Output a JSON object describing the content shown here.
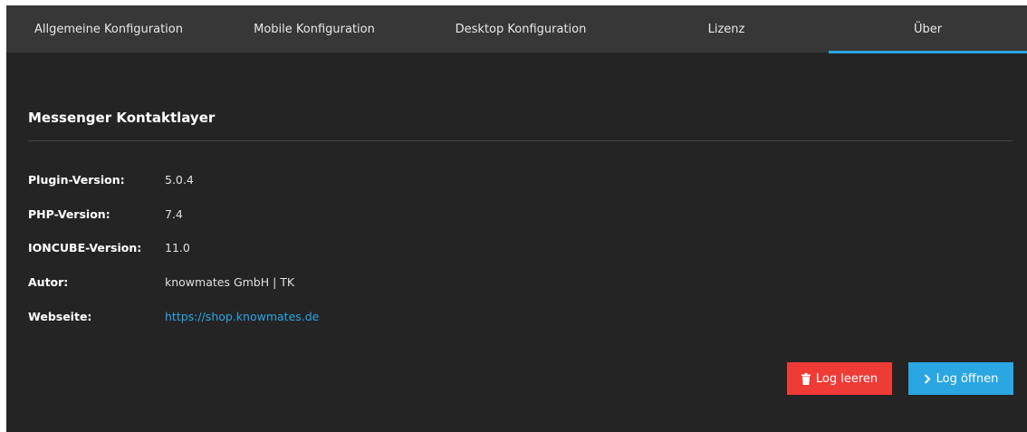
{
  "tabs": [
    {
      "label": "Allgemeine Konfiguration"
    },
    {
      "label": "Mobile Konfiguration"
    },
    {
      "label": "Desktop Konfiguration"
    },
    {
      "label": "Lizenz"
    },
    {
      "label": "Über",
      "active": true
    }
  ],
  "section": {
    "title": "Messenger Kontaktlayer"
  },
  "info": [
    {
      "label": "Plugin-Version:",
      "value": "5.0.4"
    },
    {
      "label": "PHP-Version:",
      "value": "7.4"
    },
    {
      "label": "IONCUBE-Version:",
      "value": "11.0"
    },
    {
      "label": "Autor:",
      "value": "knowmates GmbH | TK"
    },
    {
      "label": "Webseite:",
      "value": "https://shop.knowmates.de"
    }
  ],
  "buttons": {
    "clear_log": {
      "label": "Log leeren",
      "icon": "trash-icon",
      "color": "#ef3b36"
    },
    "open_log": {
      "label": "Log öffnen",
      "icon": "chevron-right-icon",
      "color": "#2aa6e3"
    }
  },
  "colors": {
    "accent": "#2aa6e3",
    "background": "#242424",
    "tabbar": "#373737"
  }
}
